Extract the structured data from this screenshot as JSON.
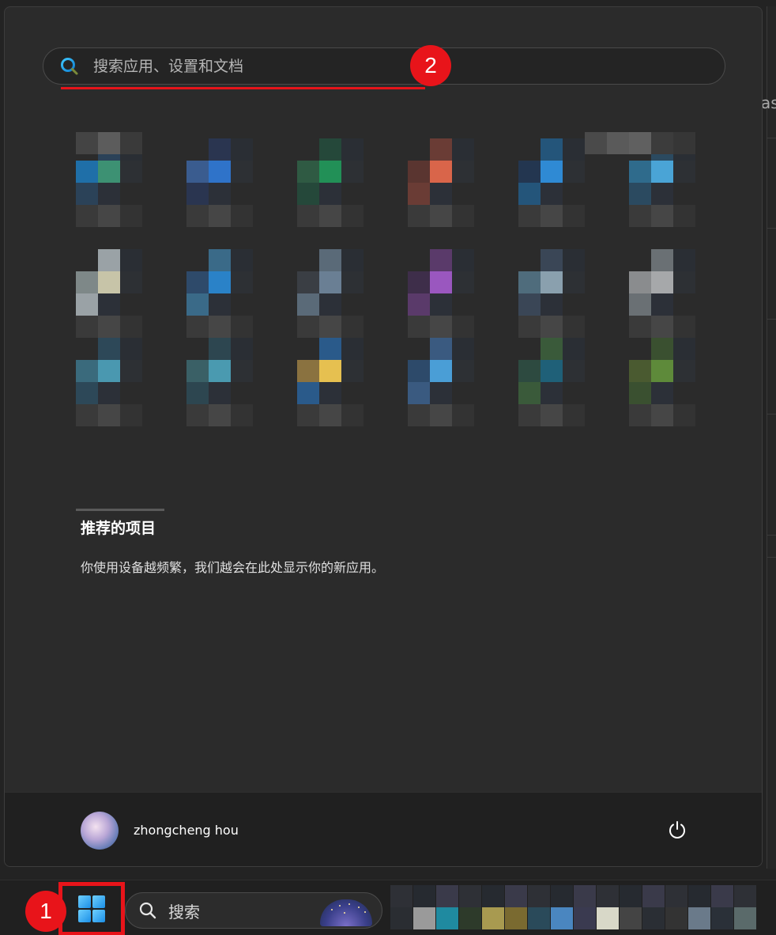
{
  "search": {
    "placeholder": "搜索应用、设置和文档"
  },
  "annotations": {
    "marker_1": "1",
    "marker_2": "2"
  },
  "recommended": {
    "title": "推荐的项目",
    "description": "你使用设备越频繁，我们越会在此处显示你的新应用。"
  },
  "user": {
    "name": "zhongcheng hou"
  },
  "taskbar": {
    "search_label": "搜索"
  },
  "background_window": {
    "partial_text": "as"
  },
  "colors": {
    "annotation_red": "#e8141a",
    "menu_bg": "#2b2b2b",
    "taskbar_bg": "#202020"
  },
  "icons": [
    "search-icon",
    "power-icon",
    "windows-start-icon",
    "user-avatar"
  ]
}
